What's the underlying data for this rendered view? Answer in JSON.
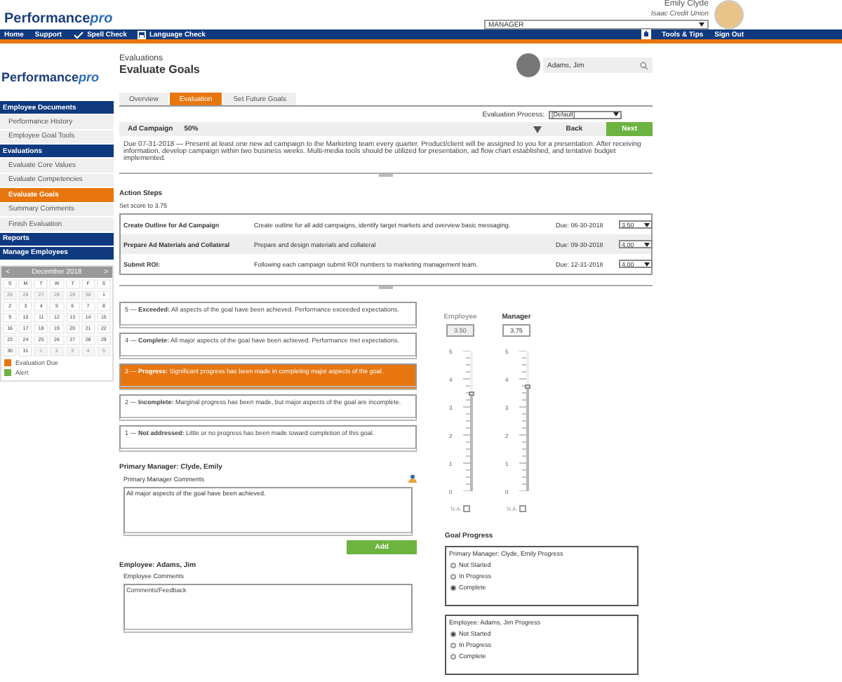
{
  "header": {
    "logo_main": "Performance",
    "logo_accent": "pro",
    "user_name": "Emily Clyde",
    "organization": "Isaac Credit Union",
    "role": "MANAGER"
  },
  "nav": {
    "left": [
      {
        "kind": "link",
        "label": "Home"
      },
      {
        "kind": "link",
        "label": "Support"
      },
      {
        "kind": "spell",
        "label": "Spell Check"
      },
      {
        "kind": "language",
        "label": "Language Check"
      }
    ],
    "right": [
      {
        "kind": "icon"
      },
      {
        "kind": "link",
        "label": "Tools & Tips"
      },
      {
        "kind": "link",
        "label": "Sign Out"
      }
    ]
  },
  "sidebar": {
    "logo_main": "Performance",
    "logo_accent": "pro",
    "groups": [
      {
        "title": "Employee Documents",
        "items": [
          {
            "label": "Performance History",
            "selected": false
          },
          {
            "label": "Employee Goal Tools",
            "selected": false
          }
        ]
      },
      {
        "title": "Evaluations",
        "items": [
          {
            "label": "Evaluate Core Values",
            "selected": false
          },
          {
            "label": "Evaluate Competencies",
            "selected": false
          },
          {
            "label": "Evaluate Goals",
            "selected": true
          },
          {
            "label": "Summary Comments",
            "selected": false
          },
          {
            "label": "Finish Evaluation",
            "selected": false
          }
        ]
      },
      {
        "title": "Reports"
      },
      {
        "title": "Manage Employees"
      }
    ]
  },
  "calendar": {
    "prev": "<",
    "month": "December 2018",
    "next": ">",
    "weekdays": [
      "S",
      "M",
      "T",
      "W",
      "T",
      "F",
      "S"
    ],
    "weeks": [
      [
        {
          "day": "25",
          "other_month": true
        },
        {
          "day": "26",
          "other_month": true
        },
        {
          "day": "27",
          "other_month": true
        },
        {
          "day": "28",
          "other_month": true
        },
        {
          "day": "29",
          "other_month": true
        },
        {
          "day": "30",
          "other_month": true
        },
        {
          "day": "1",
          "other_month": false
        }
      ],
      [
        {
          "day": "2",
          "other_month": false
        },
        {
          "day": "3",
          "other_month": false
        },
        {
          "day": "4",
          "other_month": false
        },
        {
          "day": "5",
          "other_month": false
        },
        {
          "day": "6",
          "other_month": false
        },
        {
          "day": "7",
          "other_month": false
        },
        {
          "day": "8",
          "other_month": false
        }
      ],
      [
        {
          "day": "9",
          "other_month": false
        },
        {
          "day": "10",
          "other_month": false
        },
        {
          "day": "11",
          "other_month": false
        },
        {
          "day": "12",
          "other_month": false
        },
        {
          "day": "13",
          "other_month": false
        },
        {
          "day": "14",
          "other_month": false
        },
        {
          "day": "15",
          "other_month": false
        }
      ],
      [
        {
          "day": "16",
          "other_month": false
        },
        {
          "day": "17",
          "other_month": false
        },
        {
          "day": "18",
          "other_month": false
        },
        {
          "day": "19",
          "other_month": false
        },
        {
          "day": "20",
          "other_month": false
        },
        {
          "day": "21",
          "other_month": false
        },
        {
          "day": "22",
          "other_month": false
        }
      ],
      [
        {
          "day": "23",
          "other_month": false
        },
        {
          "day": "24",
          "other_month": false
        },
        {
          "day": "25",
          "other_month": false
        },
        {
          "day": "26",
          "other_month": false
        },
        {
          "day": "27",
          "other_month": false
        },
        {
          "day": "28",
          "other_month": false
        },
        {
          "day": "29",
          "other_month": false
        }
      ],
      [
        {
          "day": "30",
          "other_month": false
        },
        {
          "day": "31",
          "other_month": false
        },
        {
          "day": "1",
          "other_month": true
        },
        {
          "day": "2",
          "other_month": true
        },
        {
          "day": "3",
          "other_month": true
        },
        {
          "day": "4",
          "other_month": true
        },
        {
          "day": "5",
          "other_month": true
        }
      ]
    ],
    "legend": [
      {
        "label": "Evaluation Due",
        "color": "#e8760f"
      },
      {
        "label": "Alert",
        "color": "#6db33f"
      }
    ]
  },
  "page": {
    "section": "Evaluations",
    "title": "Evaluate Goals",
    "employee": "Adams, Jim"
  },
  "tabs": [
    {
      "label": "Overview",
      "selected": false
    },
    {
      "label": "Evaluation",
      "selected": true
    },
    {
      "label": "Set Future Goals",
      "selected": false
    }
  ],
  "evaluation_process": {
    "label": "Evaluation Process:",
    "value": "[Default]"
  },
  "goal": {
    "name": "Ad Campaign",
    "percent": "50%",
    "back": "Back",
    "next": "Next",
    "description": "Due 07-31-2018 — Present at least one new ad campaign to the Marketing team every quarter. Product/client will be assigned to you for a presentation. After receiving information, develop campaign within two business weeks. Multi-media tools should be utilized for presentation, ad flow chart established, and tentative budget implemented."
  },
  "action_steps": {
    "title": "Action Steps",
    "note": "Set score to 3.75",
    "rows": [
      {
        "name": "Create Outline for Ad Campaign",
        "description": "Create outline for all add campaigns, identify target markets and overview basic messaging.",
        "due": "Due: 06-30-2018",
        "score": "3.50"
      },
      {
        "name": "Prepare Ad Materials and Collateral",
        "description": "Prepare and design materials and collateral",
        "due": "Due: 09-30-2018",
        "score": "4.00"
      },
      {
        "name": "Submit ROI:",
        "description": "Following each campaign submit ROI numbers to marketing management team.",
        "due": "Due: 12-31-2018",
        "score": "4.00"
      }
    ]
  },
  "ratings": [
    {
      "text": "5 — **Exceeded:** All aspects of the goal have been achieved. Performance exceeded expectations.",
      "selected": false
    },
    {
      "text": "4 — **Complete:** All major aspects of the goal have been achieved. Performance met expectations.",
      "selected": false
    },
    {
      "text": "3 — **Progress:** Significant progress has been made in completing major aspects of the goal.",
      "selected": true
    },
    {
      "text": "2 — **Incomplete:** Marginal progress has been made, but major aspects of the goal are incomplete.",
      "selected": false
    },
    {
      "text": "1 — **Not addressed:** Little or no progress has been made toward completion of this goal.",
      "selected": false
    }
  ],
  "scores": [
    {
      "label": "Employee",
      "value": "3.50",
      "level": 0.7,
      "disabled": true,
      "ticks": [
        "5",
        "4",
        "3",
        "2",
        "1",
        "0"
      ],
      "na_label": "N.A.",
      "na_checked": false
    },
    {
      "label": "Manager",
      "value": "3.75",
      "level": 0.75,
      "disabled": false,
      "ticks": [
        "5",
        "4",
        "3",
        "2",
        "1",
        "0"
      ],
      "na_label": "N.A.",
      "na_checked": false
    }
  ],
  "comments": [
    {
      "heading": "Primary Manager: Clyde, Emily",
      "toggle": "Primary Manager Comments",
      "value": "All major aspects of the goal have been achieved.",
      "button": "Add"
    },
    {
      "heading": "Employee: Adams, Jim",
      "toggle": "Employee Comments",
      "placeholder": "Comments/Feedback"
    }
  ],
  "goal_progress": {
    "title": "Goal Progress",
    "boxes": [
      {
        "title": "Primary Manager: Clyde, Emily Progress",
        "options": [
          {
            "label": "Not Started",
            "selected": false
          },
          {
            "label": "In Progress",
            "selected": false
          },
          {
            "label": "Complete",
            "selected": true
          }
        ]
      },
      {
        "title": "Employee: Adams, Jim Progress",
        "options": [
          {
            "label": "Not Started",
            "selected": true
          },
          {
            "label": "In Progress",
            "selected": false
          },
          {
            "label": "Complete",
            "selected": false
          }
        ]
      }
    ]
  }
}
